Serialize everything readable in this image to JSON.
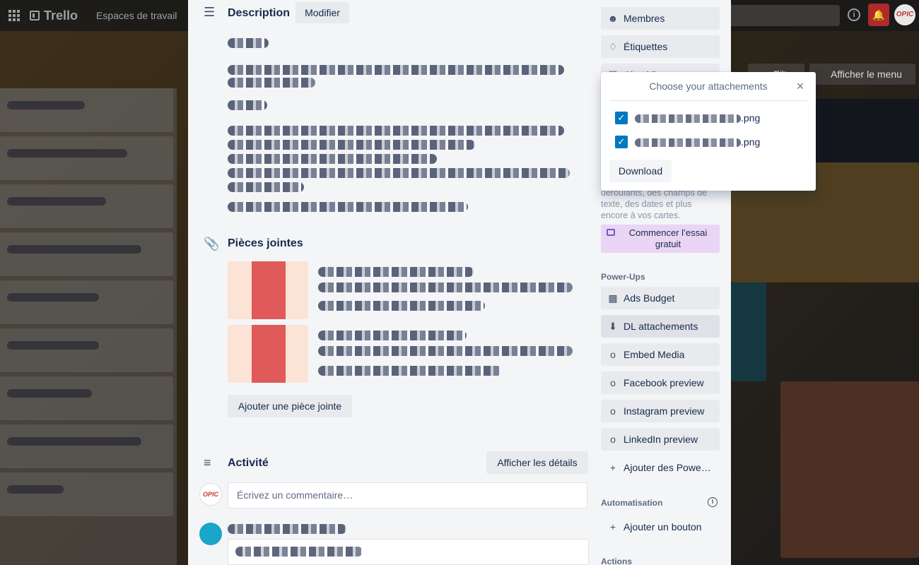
{
  "topbar": {
    "app_name": "Trello",
    "workspaces": "Espaces de travail",
    "avatar_initials": "OPIC"
  },
  "board": {
    "filter_label": "Filtre",
    "show_menu_label": "Afficher le menu"
  },
  "card": {
    "description": {
      "title": "Description",
      "edit_button": "Modifier"
    },
    "attachments": {
      "title": "Pièces jointes",
      "add_button": "Ajouter une pièce jointe"
    },
    "activity": {
      "title": "Activité",
      "details_button": "Afficher les détails",
      "comment_placeholder": "Écrivez un commentaire…",
      "user_avatar": "OPIC"
    }
  },
  "sidebar": {
    "add_to_card": [
      {
        "label": "Membres",
        "icon": "person-icon"
      },
      {
        "label": "Étiquettes",
        "icon": "tag-icon"
      },
      {
        "label": "Checklist",
        "icon": "checklist-icon"
      }
    ],
    "promo_text": "déroulants, des champs de texte, des dates et plus encore à vos cartes.",
    "trial_button": "Commencer l’essai gratuit",
    "powerups_label": "Power-Ups",
    "powerups": [
      {
        "label": "Ads Budget",
        "icon": "ads-icon"
      },
      {
        "label": "DL attachements",
        "icon": "download-icon"
      },
      {
        "label": "Embed Media",
        "icon": "powerup-icon"
      },
      {
        "label": "Facebook preview",
        "icon": "powerup-icon"
      },
      {
        "label": "Instagram preview",
        "icon": "powerup-icon"
      },
      {
        "label": "LinkedIn preview",
        "icon": "powerup-icon"
      }
    ],
    "add_powerups": "Ajouter des Powe…",
    "automation_label": "Automatisation",
    "add_button": "Ajouter un bouton",
    "actions_label": "Actions"
  },
  "popover": {
    "title": "Choose your attachements",
    "files": [
      {
        "suffix": ".png",
        "checked": true
      },
      {
        "suffix": ".png",
        "checked": true
      }
    ],
    "download_button": "Download"
  },
  "colors": {
    "accent": "#0079bf",
    "modal_bg": "#f4f5f7",
    "trial_bg": "#ead5f5",
    "notification": "#b12a2a"
  }
}
